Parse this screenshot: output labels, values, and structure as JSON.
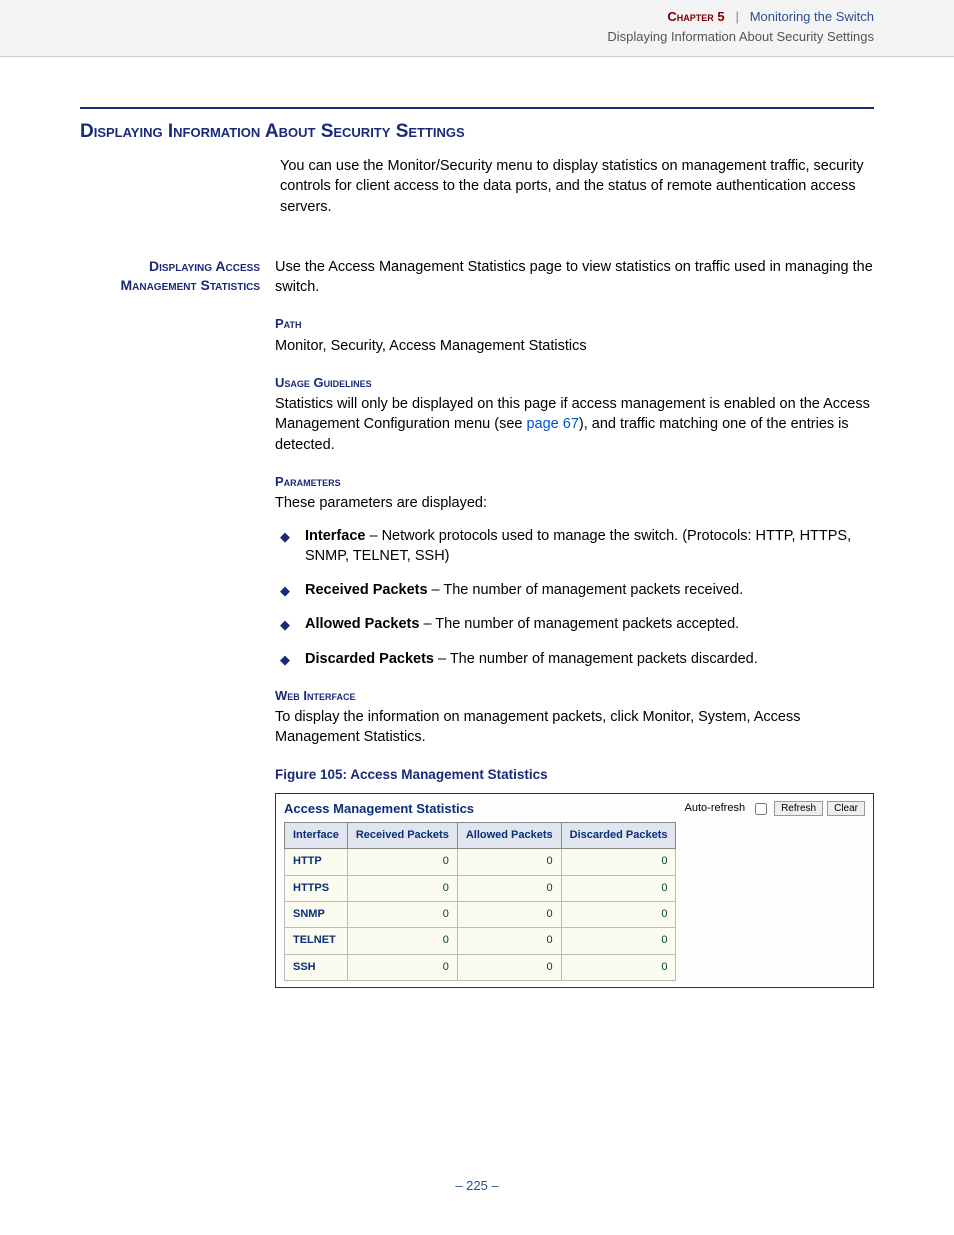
{
  "header": {
    "chapter": "Chapter 5",
    "sep": "|",
    "chapter_title": "Monitoring the Switch",
    "subtitle": "Displaying Information About Security Settings"
  },
  "section_title": "Displaying Information About Security Settings",
  "intro": "You can use the Monitor/Security menu to display statistics on management traffic, security controls for client access to the data ports, and the status of remote authentication access servers.",
  "side_heading": "Displaying Access Management Statistics",
  "main_intro": "Use the Access Management Statistics page to view statistics on traffic used in managing the switch.",
  "path_label": "Path",
  "path_text": "Monitor, Security, Access Management Statistics",
  "usage_label": "Usage Guidelines",
  "usage_pre": "Statistics will only be displayed on this page if access management is enabled on the Access Management Configuration menu (see ",
  "usage_link": "page 67",
  "usage_post": "), and traffic matching one of the entries is detected.",
  "params_label": "Parameters",
  "params_intro": "These parameters are displayed:",
  "params": [
    {
      "name": "Interface",
      "desc": " – Network protocols used to manage the switch. (Protocols: HTTP, HTTPS, SNMP, TELNET, SSH)"
    },
    {
      "name": "Received Packets",
      "desc": " – The number of management packets received."
    },
    {
      "name": "Allowed Packets",
      "desc": " – The number of management packets accepted."
    },
    {
      "name": "Discarded Packets",
      "desc": " – The number of management packets discarded."
    }
  ],
  "web_label": "Web Interface",
  "web_text": "To display the information on management packets, click Monitor, System, Access Management Statistics.",
  "figure_caption": "Figure 105:  Access Management Statistics",
  "figure": {
    "title": "Access Management Statistics",
    "autorefresh_label": "Auto-refresh",
    "btn_refresh": "Refresh",
    "btn_clear": "Clear",
    "headers": [
      "Interface",
      "Received Packets",
      "Allowed Packets",
      "Discarded Packets"
    ],
    "rows": [
      {
        "proto": "HTTP",
        "r": "0",
        "a": "0",
        "d": "0"
      },
      {
        "proto": "HTTPS",
        "r": "0",
        "a": "0",
        "d": "0"
      },
      {
        "proto": "SNMP",
        "r": "0",
        "a": "0",
        "d": "0"
      },
      {
        "proto": "TELNET",
        "r": "0",
        "a": "0",
        "d": "0"
      },
      {
        "proto": "SSH",
        "r": "0",
        "a": "0",
        "d": "0"
      }
    ]
  },
  "page_number": "–  225  –"
}
